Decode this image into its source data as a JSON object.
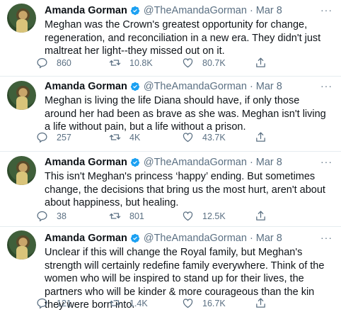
{
  "tweets": [
    {
      "name": "Amanda Gorman",
      "handle": "@TheAmandaGorman",
      "dot": "·",
      "date": "Mar 8",
      "text": "Meghan was the Crown's greatest opportunity for change, regeneration, and reconciliation in a new era. They didn't just maltreat her light--they missed out on it.",
      "replies": "860",
      "retweets": "10.8K",
      "likes": "80.7K"
    },
    {
      "name": "Amanda Gorman",
      "handle": "@TheAmandaGorman",
      "dot": "·",
      "date": "Mar 8",
      "text": "Meghan is living the life Diana should have, if only those around her had been as brave as she was. Meghan isn't living a life without pain, but a life without a prison.",
      "replies": "257",
      "retweets": "4K",
      "likes": "43.7K"
    },
    {
      "name": "Amanda Gorman",
      "handle": "@TheAmandaGorman",
      "dot": "·",
      "date": "Mar 8",
      "text": "This isn't Meghan's princess ‘happy’ ending. But sometimes change, the decisions that bring us the most hurt, aren't about about happiness, but healing.",
      "replies": "38",
      "retweets": "801",
      "likes": "12.5K"
    },
    {
      "name": "Amanda Gorman",
      "handle": "@TheAmandaGorman",
      "dot": "·",
      "date": "Mar 8",
      "text": "Unclear if this will change the Royal family, but Meghan's strength will certainly redefine family everywhere. Think of the women who will be inspired to stand up for their lives, the partners who will be kinder & more courageous than the kin they were born into.",
      "replies": "121",
      "retweets": "1.4K",
      "likes": "16.7K"
    }
  ],
  "more_glyph": "···",
  "colors": {
    "verified": "#1da1f2",
    "muted": "#5b7083",
    "text": "#0f1419"
  }
}
